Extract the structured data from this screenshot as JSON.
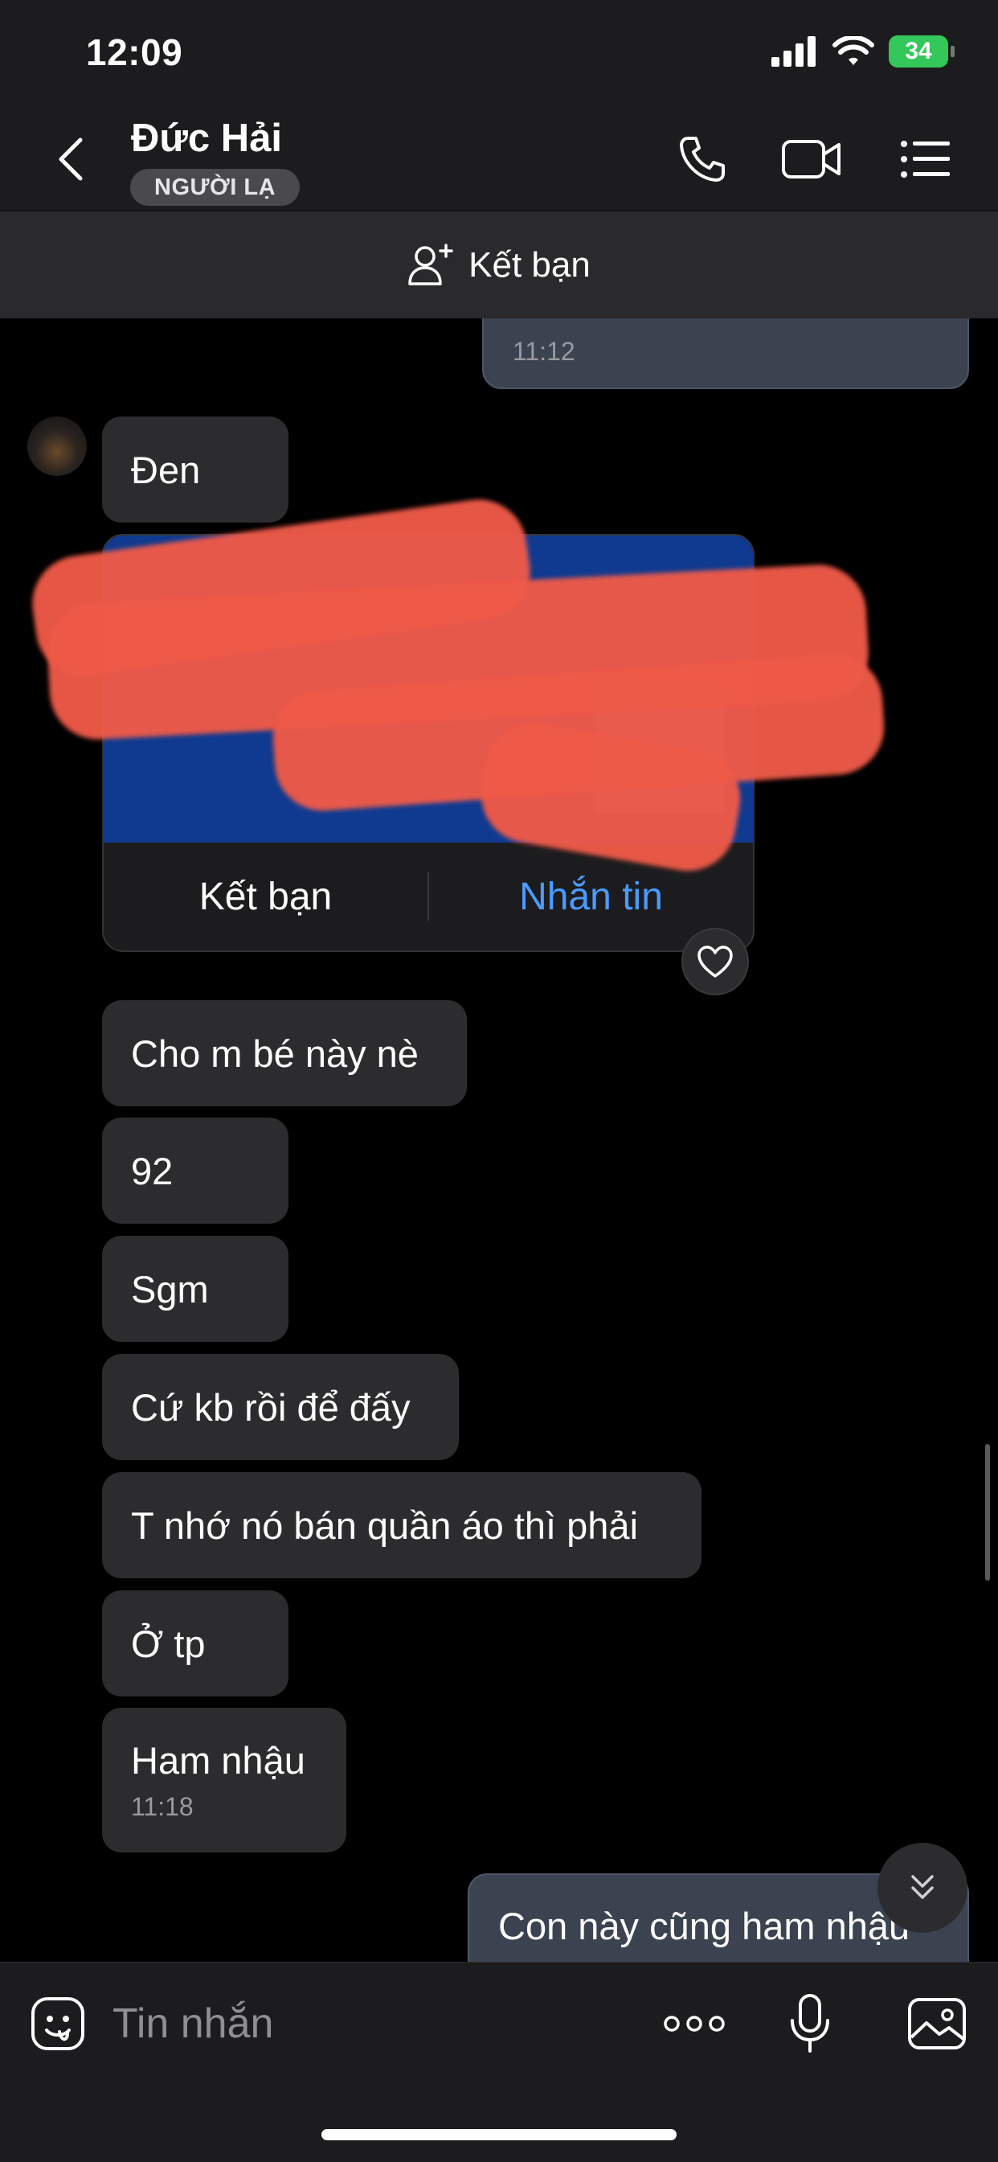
{
  "status_bar": {
    "time": "12:09",
    "battery": "34"
  },
  "header": {
    "name": "Đức Hải",
    "badge": "NGƯỜI LẠ"
  },
  "add_friend_bar": {
    "label": "Kết bạn"
  },
  "messages": {
    "out_top_time": "11:12",
    "den": "Đen",
    "card": {
      "add_label": "Kết bạn",
      "message_label": "Nhắn tin"
    },
    "m1": "Cho m bé này nè",
    "m2": "92",
    "m3": "Sgm",
    "m4": "Cứ kb rồi để đấy",
    "m5": "T nhớ nó bán quần áo thì phải",
    "m6": "Ở tp",
    "m7": "Ham nhậu",
    "m7_time": "11:18",
    "out_last": "Con này cũng ham nhậu"
  },
  "composer": {
    "placeholder": "Tin nhắn"
  },
  "colors": {
    "accent": "#4a9bff",
    "card_bg": "#0f3a8f",
    "redaction": "#ef5a48",
    "battery": "#34c759"
  }
}
